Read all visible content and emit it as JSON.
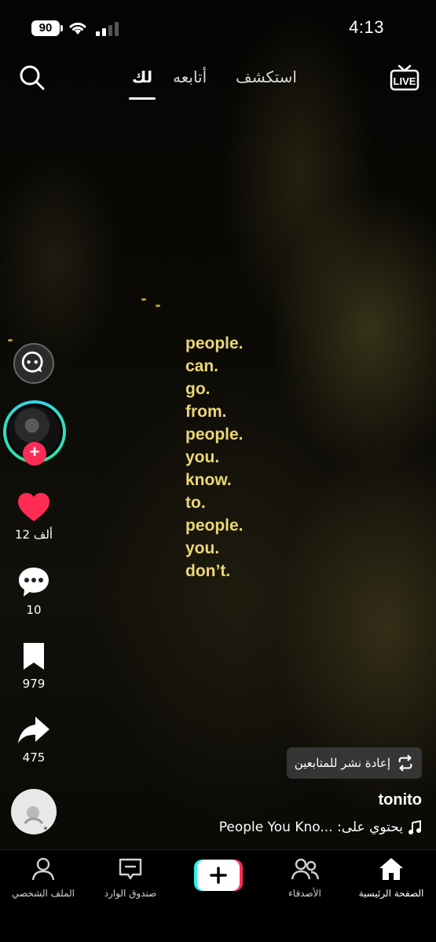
{
  "status_bar": {
    "battery": "90",
    "time": "4:13"
  },
  "top_nav": {
    "tabs": [
      {
        "label": "لك",
        "active": true
      },
      {
        "label": "أتابعه",
        "active": false
      },
      {
        "label": "استكشف",
        "active": false
      }
    ]
  },
  "video_text": [
    "people.",
    "can.",
    "go.",
    "from.",
    "people.",
    "you.",
    "know.",
    "to.",
    "people.",
    "you.",
    "don’t."
  ],
  "actions": {
    "likes": "12 ألف",
    "comments": "10",
    "bookmarks": "979",
    "shares": "475"
  },
  "post": {
    "repost_label": "إعادة نشر للمتابعين",
    "username": "tonito",
    "music_text": "People You Kno... :يحتوي على"
  },
  "bottom_nav": {
    "home": "الصفحة الرئيسية",
    "friends": "الأصدقاء",
    "inbox": "صندوق الوارد",
    "profile": "الملف الشخصي"
  },
  "colors": {
    "accent": "#fe2c55",
    "ring": "#35d6e8",
    "lyrics": "#ecd676"
  }
}
